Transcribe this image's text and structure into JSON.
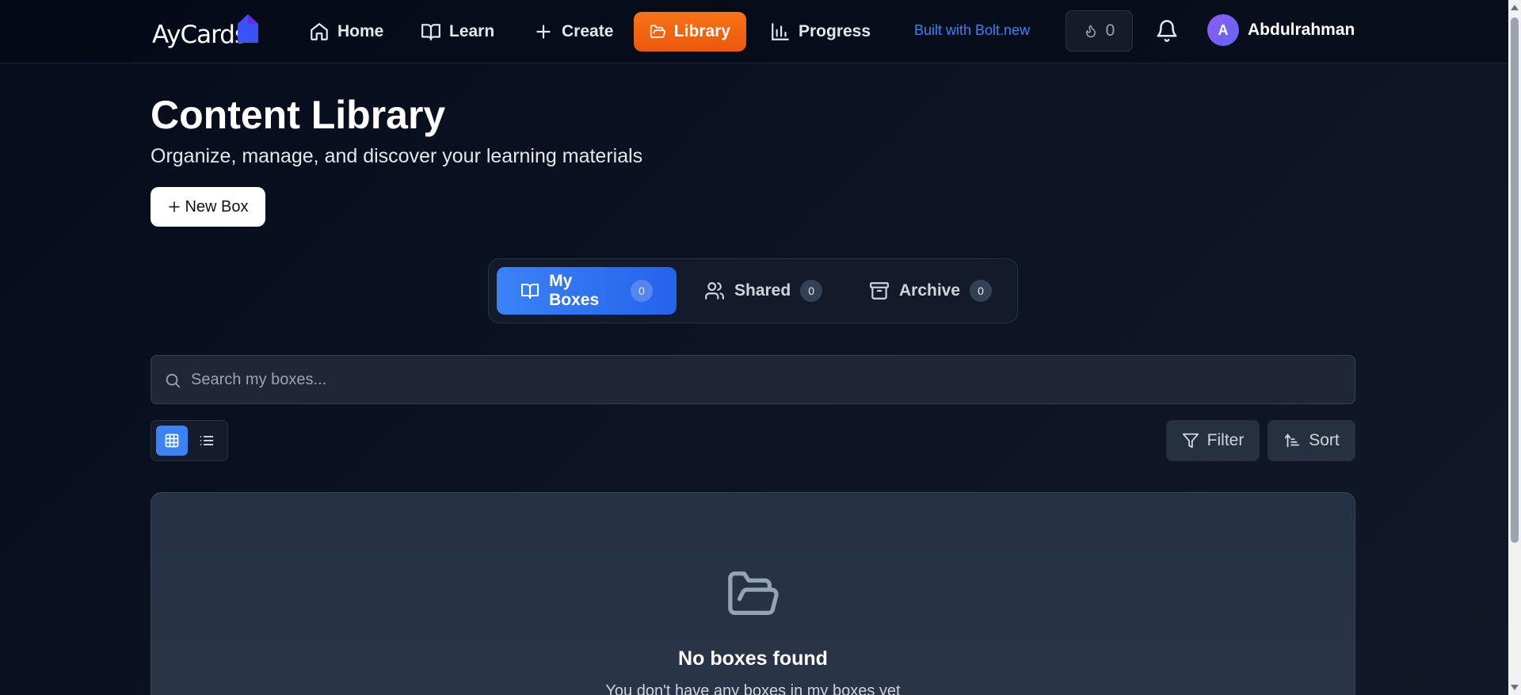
{
  "brand": {
    "logo_text": "AyCards"
  },
  "nav": {
    "items": [
      {
        "label": "Home",
        "icon": "home-icon"
      },
      {
        "label": "Learn",
        "icon": "book-open-icon"
      },
      {
        "label": "Create",
        "icon": "plus-icon"
      },
      {
        "label": "Library",
        "icon": "folder-open-icon",
        "active": true
      },
      {
        "label": "Progress",
        "icon": "bar-chart-icon"
      }
    ],
    "built_with": "Built with Bolt.new",
    "streak_count": "0",
    "user": {
      "initial": "A",
      "name": "Abdulrahman"
    }
  },
  "header": {
    "title": "Content Library",
    "subtitle": "Organize, manage, and discover your learning materials",
    "new_box_label": "New Box"
  },
  "tabs": [
    {
      "label": "My Boxes",
      "count": "0",
      "icon": "book-open-icon",
      "active": true
    },
    {
      "label": "Shared",
      "count": "0",
      "icon": "users-icon"
    },
    {
      "label": "Archive",
      "count": "0",
      "icon": "archive-icon"
    }
  ],
  "search": {
    "placeholder": "Search my boxes..."
  },
  "toolbar": {
    "filter_label": "Filter",
    "sort_label": "Sort",
    "view_mode": "grid"
  },
  "empty_state": {
    "title": "No boxes found",
    "message": "You don't have any boxes in my boxes yet"
  },
  "colors": {
    "accent_orange": "#f97316",
    "accent_blue": "#3b82f6",
    "background": "#0b1222"
  }
}
